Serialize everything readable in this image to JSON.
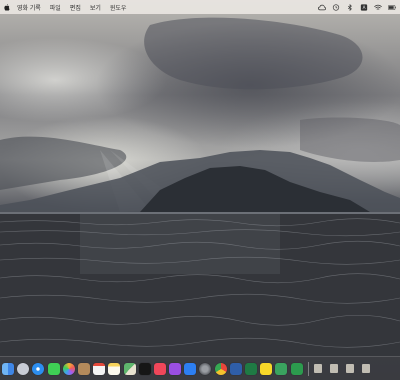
{
  "menubar": {
    "items": [
      "영화 기록",
      "파일",
      "편집",
      "보기",
      "윈도우"
    ],
    "status_icons": [
      "cloud-icon",
      "clock-icon",
      "bluetooth-icon",
      "keyboard-input-icon",
      "wifi-icon",
      "battery-icon"
    ]
  },
  "dock": {
    "apps": [
      {
        "name": "finder-icon",
        "color": "#3f86e6"
      },
      {
        "name": "launchpad-icon",
        "color": "#c8ccd6"
      },
      {
        "name": "safari-icon",
        "color": "#2c8ef0"
      },
      {
        "name": "messages-icon",
        "color": "#3fcf55"
      },
      {
        "name": "photos-icon",
        "color": "#f2b233"
      },
      {
        "name": "contacts-icon",
        "color": "#b48a5b"
      },
      {
        "name": "calendar-icon",
        "color": "#f4f4f4"
      },
      {
        "name": "notes-icon",
        "color": "#f6d25a"
      },
      {
        "name": "maps-icon",
        "color": "#5fb66d"
      },
      {
        "name": "tv-icon",
        "color": "#161616"
      },
      {
        "name": "music-icon",
        "color": "#f0475a"
      },
      {
        "name": "podcasts-icon",
        "color": "#9a4fe3"
      },
      {
        "name": "app-store-icon",
        "color": "#2d7ff2"
      },
      {
        "name": "system-preferences-icon",
        "color": "#7c7f86"
      },
      {
        "name": "chrome-icon",
        "color": "#e9e9e9"
      },
      {
        "name": "word-icon",
        "color": "#2f5ea8"
      },
      {
        "name": "excel-icon",
        "color": "#1f7a44"
      },
      {
        "name": "kakaotalk-icon",
        "color": "#f8d829"
      },
      {
        "name": "excel-doc-icon",
        "color": "#3aa35f"
      },
      {
        "name": "green-app-icon",
        "color": "#2c9b4e"
      }
    ],
    "trailing": [
      "file-icon",
      "folder-icon",
      "downloads-icon",
      "trash-icon"
    ]
  },
  "colors": {
    "menubar_bg": "#ece8e4",
    "sea": "#3a3c41",
    "mountains": "#2b2f35"
  }
}
